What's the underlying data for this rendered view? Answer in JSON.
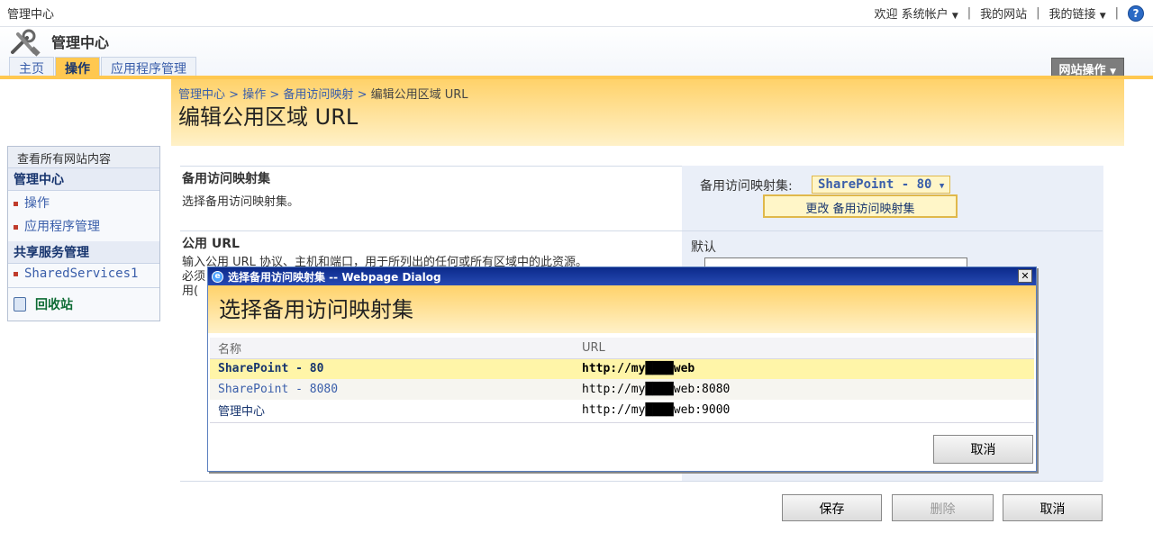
{
  "topbar": {
    "site_name": "管理中心",
    "welcome": "欢迎",
    "account": "系统帐户",
    "my_site": "我的网站",
    "my_links": "我的链接",
    "sep1": "|",
    "sep2": "|",
    "sep3": "|"
  },
  "header": {
    "title": "管理中心",
    "tabs": [
      {
        "label": "主页"
      },
      {
        "label": "操作"
      },
      {
        "label": "应用程序管理"
      }
    ],
    "site_actions": "网站操作"
  },
  "page": {
    "breadcrumb": [
      "管理中心",
      "操作",
      "备用访问映射",
      "编辑公用区域 URL"
    ],
    "breadcrumb_sep": ">",
    "title": "编辑公用区域 URL"
  },
  "leftnav": {
    "view_all": "查看所有网站内容",
    "group1_title": "管理中心",
    "group1_items": [
      "操作",
      "应用程序管理"
    ],
    "group2_title": "共享服务管理",
    "group2_items": [
      "SharedServices1"
    ],
    "recycle": "回收站"
  },
  "form": {
    "section1_title": "备用访问映射集",
    "section1_desc": "选择备用访问映射集。",
    "amc_label": "备用访问映射集:",
    "amc_value": "SharePoint - 80",
    "amc_change": "更改 备用访问映射集",
    "section2_title": "公用 URL",
    "section2_desc_line1": "输入公用 URL 协议、主机和端口，用于所列出的任何或所有区域中的此资源。",
    "section2_desc_line2": "必须",
    "section2_desc_line3": "用(",
    "zone_label": "默认",
    "save": "保存",
    "delete": "删除",
    "cancel": "取消"
  },
  "dialog": {
    "titlebar": "选择备用访问映射集 -- Webpage Dialog",
    "heading": "选择备用访问映射集",
    "col_name": "名称",
    "col_url": "URL",
    "rows": [
      {
        "name": "SharePoint - 80",
        "url": "http://my████web"
      },
      {
        "name": "SharePoint - 8080",
        "url": "http://my████web:8080"
      },
      {
        "name": "管理中心",
        "url": "http://my████web:9000"
      }
    ],
    "cancel": "取消"
  }
}
